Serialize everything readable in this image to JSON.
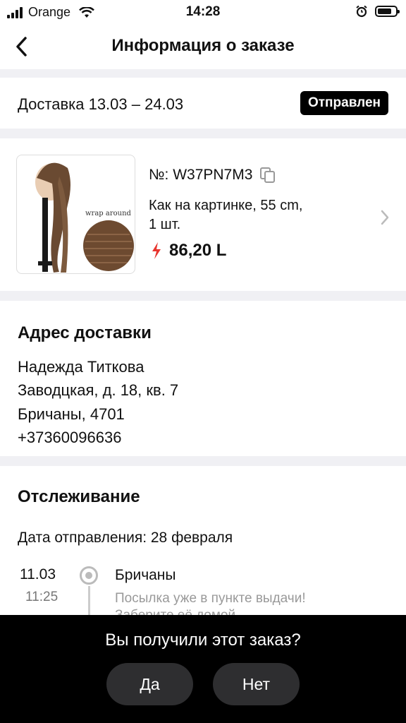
{
  "status_bar": {
    "carrier": "Orange",
    "time": "14:28"
  },
  "nav": {
    "title": "Информация о заказе"
  },
  "delivery": {
    "text": "Доставка 13.03 – 24.03",
    "status": "Отправлен"
  },
  "product": {
    "order_number": "№: W37PN7M3",
    "variant": "Как на картинке, 55 cm,",
    "quantity": "1 шт.",
    "price": "86,20 L",
    "image_caption": "wrap around"
  },
  "address": {
    "title": "Адрес доставки",
    "name": "Надежда Титкова",
    "street": "Заводцкая, д. 18, кв. 7",
    "city": "Бричаны, 4701",
    "phone": "+37360096636"
  },
  "tracking": {
    "title": "Отслеживание",
    "ship_date": "Дата отправления: 28 февраля",
    "events": [
      {
        "date": "11.03",
        "time": "11:25",
        "place": "Бричаны",
        "message": "Посылка уже в пункте выдачи!",
        "message2": "Заберите её домой"
      }
    ]
  },
  "sheet": {
    "question": "Вы получили этот заказ?",
    "yes": "Да",
    "no": "Нет"
  },
  "colors": {
    "badge_bg": "#000000",
    "price_bolt": "#e8362f",
    "section_gap": "#f0f0f4",
    "sheet_bg": "#000000",
    "sheet_button": "#2e2e30"
  },
  "icons": {
    "back": "chevron-left-icon",
    "copy": "copy-icon",
    "bolt": "lightning-icon",
    "forward": "chevron-right-icon",
    "track": "location-dot-icon"
  }
}
